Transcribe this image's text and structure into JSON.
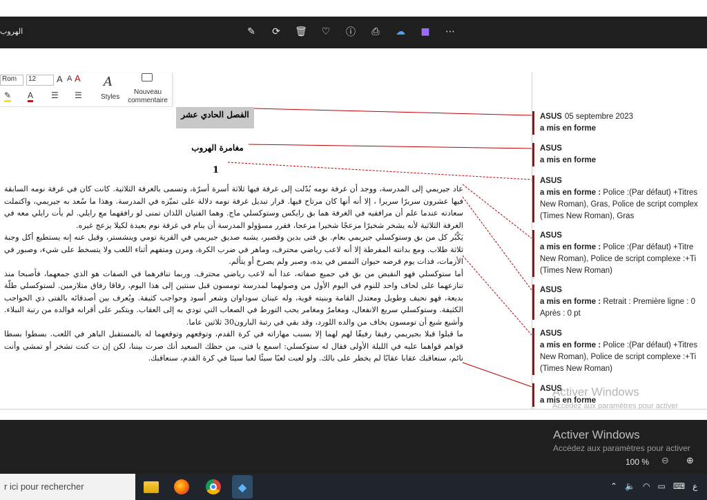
{
  "window": {
    "title": "الهروب"
  },
  "toolbar": {
    "icons": [
      "edit-icon",
      "refresh-icon",
      "delete-icon",
      "heart-icon",
      "info-icon",
      "print-icon",
      "cloud-off-icon",
      "folder-icon",
      "more-icon"
    ]
  },
  "ribbon": {
    "font_name": "Rom",
    "font_size": "12",
    "styles_label": "Styles",
    "new_comment_label": "Nouveau commentaire"
  },
  "document": {
    "chapter_title": "الفصل الحادي عشر",
    "subtitle": "مغامرة الهروب",
    "section_number": "1",
    "paragraphs": [
      "عاد جيريمي إلى المدرسة، ووجد أن غرفة نومه بُدّلت إلى غرفة فيها ثلاثة أسرة أسرّة، وتسمى بالغرفة الثلاثية. كانت كان في غرفة نومه السابقة فيها عشرون سريرًا سريرا ، إلا أنه أنها كان مرتاح فيها. قرار تبديل غرفة نومه دلالة على تميّزه في المدرسة. وهذا ما سُعد به جيريمي، واكتملت سعادته عندما علم أن مرافقيه في الغرفة هما بق رايكس وستوكسلي ماج. وهما الفتيان اللذان تمنى لو رافقهما مع رايلي. لم يأت رايلي معه في الغرفة الثلاثية لأنه يشخر شخيرًا مزعجًا شخيرا مزعجا، فقرر مسؤولو المدرسة أن ينام في غرفة نوم بعيدة لكيلا يزعج غيره.",
      "يَكْبُر كل من بق وستوكسلي جيريمي بعام. بق فتى بدين وقصير، يشبه صديق جيريمي في القرية تومي وينشستر، وقيل عنه إنه يستطيع أكل وجبة ثلاثة طلاب. ومع بدانته المفرطة إلا أنه لاعب رياضي محترف، وماهر في ضرب الكرة، ومرن ومتفهم أثناء اللعب ولا يتسخط على شيء، وصبور في الأزمات، فذات يوم قرضه حيوان النمس في يده، وصبر ولم يصرخ أو يتألم.",
      "أما ستوكسلي فهو النقيض من بق في جميع صفاته، عدا أنه لاعب رياضي محترف. وربما تنافرهما في الصفات هو الذي جمعهما، فأصبحا منذ تنازعهما على لحاف واحد للنوم في اليوم الأول من وصولهما لمدرسة تومسون قبل سنتين إلى هذا اليوم، رفاقا رفاق متلازمين. لستوكسلي طلّة بديعة، فهو نحيف وطويل ومعتدل القامة وبنيته قوية، وله عينان سوداوان وشعر أسود وحواجب كثيفة. ويُعرف بين أصدقائه بالفتى ذي الحواجب الكثيفة. وستوكسلي سريع الانفعال، ومغامرٌ ومغامر يحب التورط في الصعاب التي تودي به إلى العقاب. ويتكبر على أقرانه فوالده من رتبة النبلاء. وأشيع شيع أن تومسون يخاف من والده اللورد، وقد بقي في رتبة البارون30 ثلاثين عاما.",
      "ما قبلوا قبلا بجيريمي رفيقا رفيقًا لهم لهما إلا بسبب مهاراته في كرة القدم، وتوقعهم وتوقعهما له بالمستقبل الباهر في اللعب. بسطوا بسطا قواهم قواهما عليه في الليلة الأولى فقال له ستوكسلي: اسمع يا فتى، من حظك السعيد أنك صرت بيننا، لكن إن ت كنت تشخر أو تمشي وأنت نائم، سنعاقبك عقابا عقابًا لم يخطر على بالك. ولو لعبت لعبًا سيئًا لعبا سيئا في كرة القدم، سنعاقبك."
    ]
  },
  "comments": [
    {
      "author": "ASUS",
      "date": "05 septembre 2023",
      "action": "a mis en forme",
      "details": []
    },
    {
      "author": "ASUS",
      "date": "",
      "action": "a mis en forme",
      "details": []
    },
    {
      "author": "ASUS",
      "date": "",
      "action": "a mis en forme :",
      "details": [
        "Police :(Par défaut) +Titres",
        "New Roman), Gras, Police de script complex",
        "(Times New Roman), Gras"
      ]
    },
    {
      "author": "ASUS",
      "date": "",
      "action": "a mis en forme :",
      "details": [
        "Police :(Par défaut) +Titre",
        "New Roman), Police de script complexe :+Ti",
        "(Times New Roman)"
      ]
    },
    {
      "author": "ASUS",
      "date": "",
      "action": "a mis en forme :",
      "details": [
        "Retrait : Première ligne : 0",
        "Après : 0 pt"
      ]
    },
    {
      "author": "ASUS",
      "date": "",
      "action": "a mis en forme :",
      "details": [
        "Police :(Par défaut) +Titres",
        "New Roman), Police de script complexe :+Ti",
        "(Times New Roman)"
      ]
    },
    {
      "author": "ASUS",
      "date": "",
      "action": "a mis en forme",
      "details": []
    }
  ],
  "watermark": {
    "line1": "Activer Windows",
    "line2": "Accédez aux paramètres pour activer"
  },
  "status": {
    "zoom": "100 %"
  },
  "taskbar": {
    "search_text": "r ici pour rechercher",
    "tray_time": "ع"
  },
  "colors": {
    "revision_red": "#c00000",
    "chrome_dark": "#1f1f1f",
    "taskbar": "#20252c"
  }
}
